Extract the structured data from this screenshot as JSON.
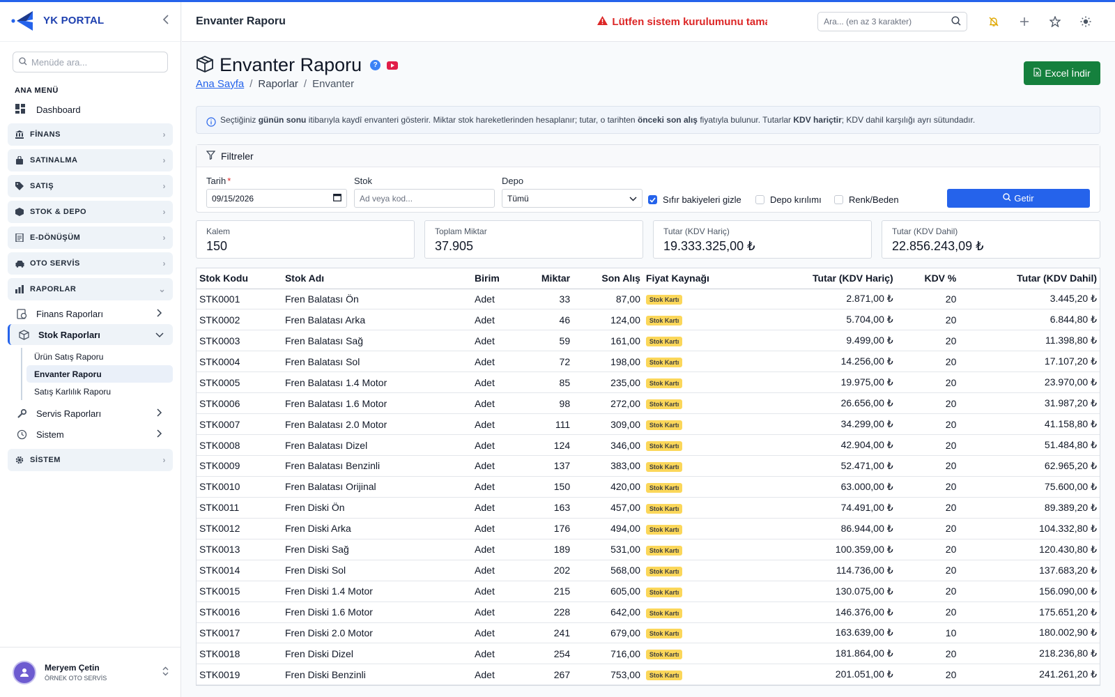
{
  "brand": {
    "name": "YK PORTAL"
  },
  "sidebar": {
    "search_placeholder": "Menüde ara...",
    "menu_title": "ANA MENÜ",
    "dashboard": "Dashboard",
    "groups": [
      {
        "label": "FİNANS",
        "icon": "bank-icon"
      },
      {
        "label": "SATINALMA",
        "icon": "bag-icon"
      },
      {
        "label": "SATIŞ",
        "icon": "tag-icon"
      },
      {
        "label": "STOK & DEPO",
        "icon": "box-icon"
      },
      {
        "label": "E-DÖNÜŞÜM",
        "icon": "document-icon"
      },
      {
        "label": "OTO SERVİS",
        "icon": "car-icon"
      },
      {
        "label": "RAPORLAR",
        "icon": "chart-icon"
      }
    ],
    "report_items": [
      {
        "label": "Finans Raporları"
      },
      {
        "label": "Stok Raporları"
      }
    ],
    "stock_reports": [
      "Ürün Satış Raporu",
      "Envanter Raporu",
      "Satış Karlılık Raporu"
    ],
    "more_items": [
      {
        "label": "Servis Raporları"
      },
      {
        "label": "Sistem"
      }
    ],
    "system_group": "SİSTEM"
  },
  "user": {
    "name": "Meryem Çetin",
    "org": "ÖRNEK OTO SERVİS"
  },
  "header": {
    "title": "Envanter Raporu",
    "warning": "Lütfen sistem kurulumunu tamamlayın",
    "search_placeholder": "Ara... (en az 3 karakter)"
  },
  "page": {
    "title": "Envanter Raporu",
    "help": "?",
    "breadcrumb": {
      "home": "Ana Sayfa",
      "mid": "Raporlar",
      "current": "Envanter"
    },
    "excel_label": "Excel İndir"
  },
  "info": {
    "t1": "Seçtiğiniz ",
    "b1": "günün sonu",
    "t2": " itibarıyla kaydî envanteri gösterir. Miktar stok hareketlerinden hesaplanır; tutar, o tarihten ",
    "b2": "önceki son alış",
    "t3": " fiyatıyla bulunur. Tutarlar ",
    "b3": "KDV hariçtir",
    "t4": "; KDV dahil karşılığı ayrı sütundadır."
  },
  "filters": {
    "title": "Filtreler",
    "date_label": "Tarih",
    "date_required": "*",
    "date_value": "09/15/2026",
    "stock_label": "Stok",
    "stock_placeholder": "Ad veya kod...",
    "depot_label": "Depo",
    "depot_value": "Tümü",
    "check_zero": "Sıfır bakiyeleri gizle",
    "check_depot": "Depo kırılımı",
    "check_color": "Renk/Beden",
    "submit": "Getir"
  },
  "stats": [
    {
      "label": "Kalem",
      "value": "150"
    },
    {
      "label": "Toplam Miktar",
      "value": "37.905"
    },
    {
      "label": "Tutar (KDV Hariç)",
      "value": "19.333.325,00 ₺"
    },
    {
      "label": "Tutar (KDV Dahil)",
      "value": "22.856.243,09 ₺"
    }
  ],
  "table": {
    "headers": [
      "Stok Kodu",
      "Stok Adı",
      "Birim",
      "Miktar",
      "Son Alış",
      "Fiyat Kaynağı",
      "Tutar (KDV Hariç)",
      "KDV %",
      "Tutar (KDV Dahil)"
    ],
    "rows": [
      [
        "STK0001",
        "Fren Balatası Ön",
        "Adet",
        "33",
        "87,00",
        "Stok Kartı",
        "2.871,00 ₺",
        "20",
        "3.445,20 ₺"
      ],
      [
        "STK0002",
        "Fren Balatası Arka",
        "Adet",
        "46",
        "124,00",
        "Stok Kartı",
        "5.704,00 ₺",
        "20",
        "6.844,80 ₺"
      ],
      [
        "STK0003",
        "Fren Balatası Sağ",
        "Adet",
        "59",
        "161,00",
        "Stok Kartı",
        "9.499,00 ₺",
        "20",
        "11.398,80 ₺"
      ],
      [
        "STK0004",
        "Fren Balatası Sol",
        "Adet",
        "72",
        "198,00",
        "Stok Kartı",
        "14.256,00 ₺",
        "20",
        "17.107,20 ₺"
      ],
      [
        "STK0005",
        "Fren Balatası 1.4 Motor",
        "Adet",
        "85",
        "235,00",
        "Stok Kartı",
        "19.975,00 ₺",
        "20",
        "23.970,00 ₺"
      ],
      [
        "STK0006",
        "Fren Balatası 1.6 Motor",
        "Adet",
        "98",
        "272,00",
        "Stok Kartı",
        "26.656,00 ₺",
        "20",
        "31.987,20 ₺"
      ],
      [
        "STK0007",
        "Fren Balatası 2.0 Motor",
        "Adet",
        "111",
        "309,00",
        "Stok Kartı",
        "34.299,00 ₺",
        "20",
        "41.158,80 ₺"
      ],
      [
        "STK0008",
        "Fren Balatası Dizel",
        "Adet",
        "124",
        "346,00",
        "Stok Kartı",
        "42.904,00 ₺",
        "20",
        "51.484,80 ₺"
      ],
      [
        "STK0009",
        "Fren Balatası Benzinli",
        "Adet",
        "137",
        "383,00",
        "Stok Kartı",
        "52.471,00 ₺",
        "20",
        "62.965,20 ₺"
      ],
      [
        "STK0010",
        "Fren Balatası Orijinal",
        "Adet",
        "150",
        "420,00",
        "Stok Kartı",
        "63.000,00 ₺",
        "20",
        "75.600,00 ₺"
      ],
      [
        "STK0011",
        "Fren Diski Ön",
        "Adet",
        "163",
        "457,00",
        "Stok Kartı",
        "74.491,00 ₺",
        "20",
        "89.389,20 ₺"
      ],
      [
        "STK0012",
        "Fren Diski Arka",
        "Adet",
        "176",
        "494,00",
        "Stok Kartı",
        "86.944,00 ₺",
        "20",
        "104.332,80 ₺"
      ],
      [
        "STK0013",
        "Fren Diski Sağ",
        "Adet",
        "189",
        "531,00",
        "Stok Kartı",
        "100.359,00 ₺",
        "20",
        "120.430,80 ₺"
      ],
      [
        "STK0014",
        "Fren Diski Sol",
        "Adet",
        "202",
        "568,00",
        "Stok Kartı",
        "114.736,00 ₺",
        "20",
        "137.683,20 ₺"
      ],
      [
        "STK0015",
        "Fren Diski 1.4 Motor",
        "Adet",
        "215",
        "605,00",
        "Stok Kartı",
        "130.075,00 ₺",
        "20",
        "156.090,00 ₺"
      ],
      [
        "STK0016",
        "Fren Diski 1.6 Motor",
        "Adet",
        "228",
        "642,00",
        "Stok Kartı",
        "146.376,00 ₺",
        "20",
        "175.651,20 ₺"
      ],
      [
        "STK0017",
        "Fren Diski 2.0 Motor",
        "Adet",
        "241",
        "679,00",
        "Stok Kartı",
        "163.639,00 ₺",
        "10",
        "180.002,90 ₺"
      ],
      [
        "STK0018",
        "Fren Diski Dizel",
        "Adet",
        "254",
        "716,00",
        "Stok Kartı",
        "181.864,00 ₺",
        "20",
        "218.236,80 ₺"
      ],
      [
        "STK0019",
        "Fren Diski Benzinli",
        "Adet",
        "267",
        "753,00",
        "Stok Kartı",
        "201.051,00 ₺",
        "20",
        "241.261,20 ₺"
      ]
    ]
  },
  "colors": {
    "accent": "#2563eb",
    "excel": "#15803d",
    "warning": "#dc2626",
    "badge": "#fbd75a"
  }
}
